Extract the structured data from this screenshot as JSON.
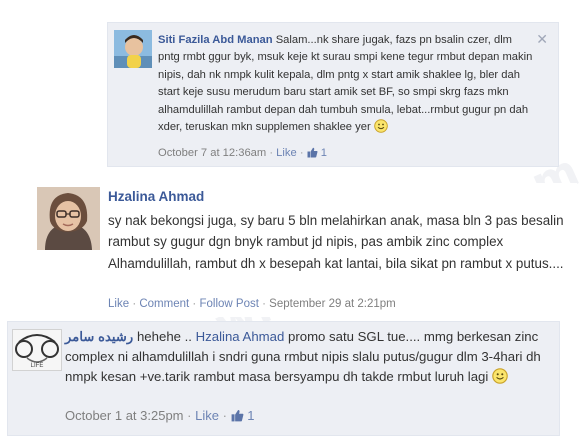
{
  "comments": [
    {
      "author": "Siti Fazila Abd Manan",
      "text": "Salam...nk share jugak, fazs pn bsalin czer, dlm pntg rmbt ggur byk, msuk keje kt surau smpi kene tegur rmbut depan makin nipis, dah nk nmpk kulit kepala, dlm pntg x start amik shaklee lg, bler dah start keje susu merudum baru start amik set BF, so smpi skrg fazs mkn alhamdulillah rambut depan dah tumbuh smula, lebat...rmbut gugur pn dah xder, teruskan mkn supplemen shaklee yer",
      "time": "October 7 at 12:36am",
      "like_label": "Like",
      "like_count": "1",
      "close_glyph": "✕"
    },
    {
      "author": "Hzalina Ahmad",
      "text": "sy nak bekongsi juga, sy baru 5 bln melahirkan anak, masa bln 3 pas besalin rambut sy gugur dgn bnyk rambut jd nipis, pas ambik zinc complex Alhamdulillah, rambut dh x besepah kat lantai, bila sikat pn rambut x putus....",
      "like_label": "Like",
      "comment_label": "Comment",
      "follow_label": "Follow Post",
      "time": "September 29 at 2:21pm"
    },
    {
      "author": "رشيده سامر",
      "text_before": " hehehe .. ",
      "mention": "Hzalina Ahmad",
      "text_after": " promo satu SGL tue.... mmg berkesan zinc complex ni alhamdulillah i sndri guna rmbut nipis slalu putus/gugur dlm 3-4hari dh nmpk kesan +ve.tarik rambut masa bersyampu dh takde rmbut luruh lagi",
      "time": "October 1 at 3:25pm",
      "like_label": "Like",
      "like_count": "1",
      "avatar_text": "LIFE"
    }
  ],
  "separator": "·",
  "watermark": "www.mama2r.com",
  "colors": {
    "link": "#3b5998",
    "meta_link": "#6d84b4",
    "comment_bg": "#edeff4"
  }
}
